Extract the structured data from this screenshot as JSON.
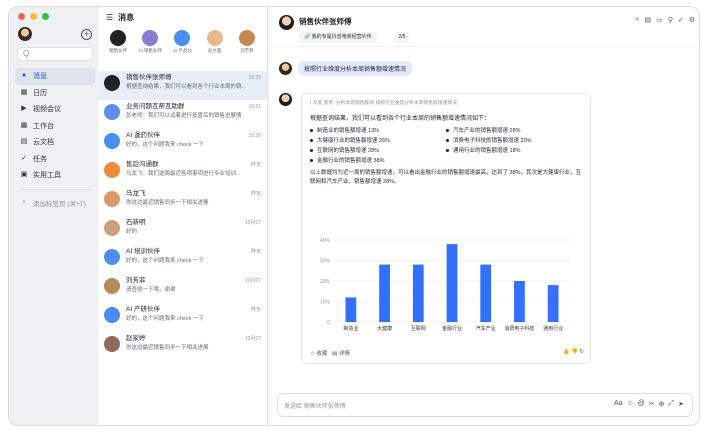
{
  "colors": {
    "accent": "#3370ff",
    "bar": "#3370ff",
    "bubble": "#e1eaff",
    "selected": "#e8eef8"
  },
  "window": {
    "traffic": [
      "#ff5f57",
      "#febc2e",
      "#28c840"
    ]
  },
  "sidebar": {
    "search_placeholder": "Q",
    "items": [
      {
        "label": "消息",
        "icon": "chat-icon",
        "active": true
      },
      {
        "label": "日历",
        "icon": "calendar-icon"
      },
      {
        "label": "视频会议",
        "icon": "video-icon"
      },
      {
        "label": "工作台",
        "icon": "grid-icon"
      },
      {
        "label": "云文档",
        "icon": "doc-icon"
      },
      {
        "label": "任务",
        "icon": "check-icon"
      },
      {
        "label": "实用工具",
        "icon": "tools-icon"
      }
    ],
    "add_label": "添加标签页 (⌘+T)"
  },
  "chatlist": {
    "title": "消息",
    "pinned": [
      {
        "name": "销售伙伴",
        "color": "#222"
      },
      {
        "name": "AI 销售伙伴",
        "color": "#8a7bd6"
      },
      {
        "name": "AI 产品伙",
        "color": "#4a8ef0"
      },
      {
        "name": "赵文晨",
        "color": "#e8b88a"
      },
      {
        "name": "刘芳菲",
        "color": "#c7884e"
      }
    ],
    "rows": [
      {
        "name": "销售伙伴张师傅",
        "time": "15:35",
        "sub": "根据查询结果，我们可以看到各个行业本周的销...",
        "color": "#222",
        "selected": true
      },
      {
        "name": "业务问题互帮互助群",
        "time": "10:21",
        "sub": "张老师：我们可以试着进行复盘后的销售进展情",
        "color": "#5b8def"
      },
      {
        "name": "AI 運药伙伴",
        "time": "15:36",
        "sub": "好的，这个问题我来 check 一下",
        "color": "#4a8ef0"
      },
      {
        "name": "售后沟通群",
        "time": "昨天",
        "sub": "马龙飞：我们这周最近各项事项进行专业培训...",
        "color": "#f08a3c"
      },
      {
        "name": "马龙飞",
        "time": "昨天",
        "sub": "你这边最近销售同步一下相关进展",
        "color": "#d99a6c"
      },
      {
        "name": "石新明",
        "time": "10月27",
        "sub": "好的",
        "color": "#caa07a"
      },
      {
        "name": "AI 培训伙伴",
        "time": "昨天",
        "sub": "好的，这个问题我来 check 一下",
        "color": "#4a8ef0"
      },
      {
        "name": "刘芳菲",
        "time": "10月27",
        "sub": "请查收一下哦，谢谢",
        "color": "#b98a5e"
      },
      {
        "name": "AI 产研伙伴",
        "time": "昨天",
        "sub": "好的，这个问题我来 check 一下",
        "color": "#4a8ef0"
      },
      {
        "name": "赵家婷",
        "time": "10月27",
        "sub": "你这边最近销售同步一下相关进展",
        "color": "#8c6a55"
      }
    ]
  },
  "main": {
    "title": "销售伙伴张师傅",
    "tag": "我的专属抖音电商经营伙伴",
    "tag2": "2/5",
    "tools": [
      "search-icon",
      "doc-icon",
      "folder-icon",
      "pin-icon",
      "check-icon",
      "gear-icon"
    ],
    "user_msg": "按照行业维度分析本周销售额增速情况",
    "reply": {
      "ref": "| 深度 思考: 分析本周销售额增 按照行业维度分析本周销售额增速情况",
      "intro": "根据查询结果，我们可以看到各个行业本周的销售额增速情况如下：",
      "bullets": [
        "制造业的销售额增速 13%",
        "汽车产业的销售额增速 28%",
        "大健康行业的销售额增速 26%",
        "消费电子科技的销售额增速 20%",
        "互联网的销售额增速 28%",
        "通用行业的销售额增速 18%",
        "金融行业的销售额增速 38%"
      ],
      "para": "以上数据均为近一周的销售额增速，可以看出金融行业的销售额增速最高，达到了 38%，其次是大健康行业，互联网和汽车产业，销售额增速 28%。",
      "like_label": "收藏",
      "detail_label": "详情"
    },
    "input_placeholder": "发送给 销售伙伴张师傅"
  },
  "chart_data": {
    "type": "bar",
    "categories": [
      "制造业",
      "大健康",
      "互联网",
      "金融行业",
      "汽车产业",
      "消费电子科技",
      "通用行业"
    ],
    "values": [
      12,
      28,
      28,
      38,
      28,
      20,
      18
    ],
    "ylim": [
      0,
      40
    ],
    "yticks": [
      "0",
      "10%",
      "20%",
      "30%",
      "40%"
    ],
    "grid": true
  }
}
